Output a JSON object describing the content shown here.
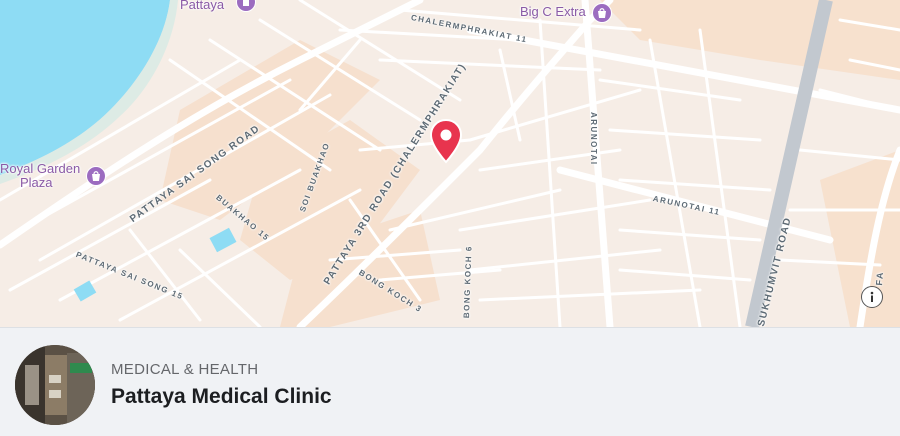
{
  "map": {
    "water_color": "#8edcf4",
    "land_color": "#f6ede6",
    "road_color": "#ffffff",
    "highway_color": "#c2c8cf",
    "pin_color": "#e8344e",
    "labels": {
      "pattaya_sai_song_road": "PATTAYA SAI SONG ROAD",
      "pattaya_3rd_road": "PATTAYA 3RD ROAD (CHALERMPHRAKIAT)",
      "chalermphrakiat_11": "CHALERMPHRAKIAT 11",
      "arunotai": "ARUNOTAI",
      "arunotai_11": "ARUNOTAI 11",
      "soi_buakhao": "SOI BUAKHAO",
      "buakhao_15": "BUAKHAO 15",
      "pattaya_sai_song_15": "PATTAYA SAI SONG 15",
      "bong_koch_3": "BONG KOCH 3",
      "bong_koch_6": "BONG KOCH 6",
      "sukhumvit_road": "SUKHUMVIT ROAD",
      "faa_road": "FA"
    },
    "pois": {
      "pattaya": "Pattaya",
      "big_c_extra": "Big C Extra",
      "royal_garden_line1": "Royal Garden",
      "royal_garden_line2": "Plaza"
    },
    "info_icon": "info-icon"
  },
  "card": {
    "category": "MEDICAL & HEALTH",
    "name": "Pattaya Medical Clinic"
  }
}
